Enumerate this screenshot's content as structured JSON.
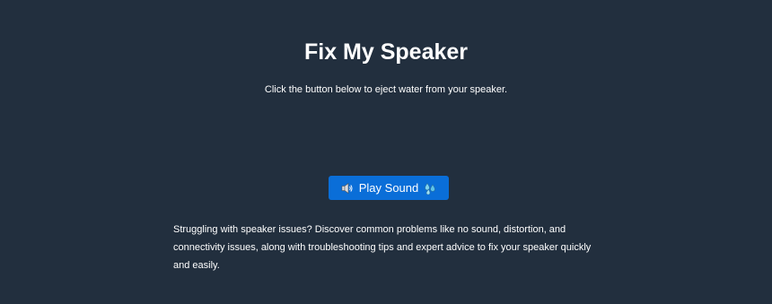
{
  "header": {
    "title": "Fix My Speaker",
    "subtitle": "Click the button below to eject water from your speaker."
  },
  "action": {
    "play_label": "Play Sound",
    "left_icon": "speaker-icon",
    "right_icon": "water-drop-icon"
  },
  "body": {
    "description": "Struggling with speaker issues? Discover common problems like no sound, distortion, and connectivity issues, along with troubleshooting tips and expert advice to fix your speaker quickly and easily."
  },
  "colors": {
    "background": "#222f3e",
    "button": "#0a6ed8",
    "text": "#ffffff"
  }
}
